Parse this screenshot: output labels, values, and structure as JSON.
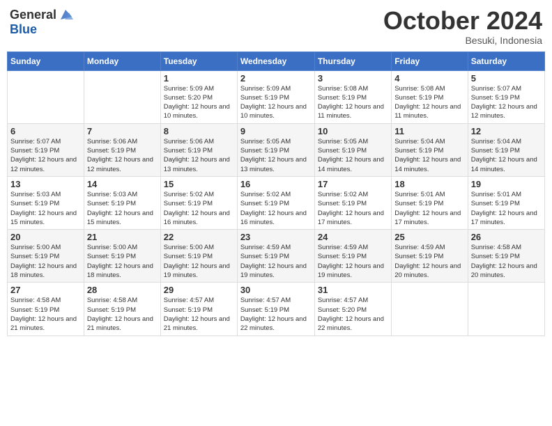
{
  "logo": {
    "general": "General",
    "blue": "Blue"
  },
  "header": {
    "month": "October 2024",
    "location": "Besuki, Indonesia"
  },
  "weekdays": [
    "Sunday",
    "Monday",
    "Tuesday",
    "Wednesday",
    "Thursday",
    "Friday",
    "Saturday"
  ],
  "weeks": [
    [
      {
        "day": "",
        "info": ""
      },
      {
        "day": "",
        "info": ""
      },
      {
        "day": "1",
        "info": "Sunrise: 5:09 AM\nSunset: 5:20 PM\nDaylight: 12 hours and 10 minutes."
      },
      {
        "day": "2",
        "info": "Sunrise: 5:09 AM\nSunset: 5:19 PM\nDaylight: 12 hours and 10 minutes."
      },
      {
        "day": "3",
        "info": "Sunrise: 5:08 AM\nSunset: 5:19 PM\nDaylight: 12 hours and 11 minutes."
      },
      {
        "day": "4",
        "info": "Sunrise: 5:08 AM\nSunset: 5:19 PM\nDaylight: 12 hours and 11 minutes."
      },
      {
        "day": "5",
        "info": "Sunrise: 5:07 AM\nSunset: 5:19 PM\nDaylight: 12 hours and 12 minutes."
      }
    ],
    [
      {
        "day": "6",
        "info": "Sunrise: 5:07 AM\nSunset: 5:19 PM\nDaylight: 12 hours and 12 minutes."
      },
      {
        "day": "7",
        "info": "Sunrise: 5:06 AM\nSunset: 5:19 PM\nDaylight: 12 hours and 12 minutes."
      },
      {
        "day": "8",
        "info": "Sunrise: 5:06 AM\nSunset: 5:19 PM\nDaylight: 12 hours and 13 minutes."
      },
      {
        "day": "9",
        "info": "Sunrise: 5:05 AM\nSunset: 5:19 PM\nDaylight: 12 hours and 13 minutes."
      },
      {
        "day": "10",
        "info": "Sunrise: 5:05 AM\nSunset: 5:19 PM\nDaylight: 12 hours and 14 minutes."
      },
      {
        "day": "11",
        "info": "Sunrise: 5:04 AM\nSunset: 5:19 PM\nDaylight: 12 hours and 14 minutes."
      },
      {
        "day": "12",
        "info": "Sunrise: 5:04 AM\nSunset: 5:19 PM\nDaylight: 12 hours and 14 minutes."
      }
    ],
    [
      {
        "day": "13",
        "info": "Sunrise: 5:03 AM\nSunset: 5:19 PM\nDaylight: 12 hours and 15 minutes."
      },
      {
        "day": "14",
        "info": "Sunrise: 5:03 AM\nSunset: 5:19 PM\nDaylight: 12 hours and 15 minutes."
      },
      {
        "day": "15",
        "info": "Sunrise: 5:02 AM\nSunset: 5:19 PM\nDaylight: 12 hours and 16 minutes."
      },
      {
        "day": "16",
        "info": "Sunrise: 5:02 AM\nSunset: 5:19 PM\nDaylight: 12 hours and 16 minutes."
      },
      {
        "day": "17",
        "info": "Sunrise: 5:02 AM\nSunset: 5:19 PM\nDaylight: 12 hours and 17 minutes."
      },
      {
        "day": "18",
        "info": "Sunrise: 5:01 AM\nSunset: 5:19 PM\nDaylight: 12 hours and 17 minutes."
      },
      {
        "day": "19",
        "info": "Sunrise: 5:01 AM\nSunset: 5:19 PM\nDaylight: 12 hours and 17 minutes."
      }
    ],
    [
      {
        "day": "20",
        "info": "Sunrise: 5:00 AM\nSunset: 5:19 PM\nDaylight: 12 hours and 18 minutes."
      },
      {
        "day": "21",
        "info": "Sunrise: 5:00 AM\nSunset: 5:19 PM\nDaylight: 12 hours and 18 minutes."
      },
      {
        "day": "22",
        "info": "Sunrise: 5:00 AM\nSunset: 5:19 PM\nDaylight: 12 hours and 19 minutes."
      },
      {
        "day": "23",
        "info": "Sunrise: 4:59 AM\nSunset: 5:19 PM\nDaylight: 12 hours and 19 minutes."
      },
      {
        "day": "24",
        "info": "Sunrise: 4:59 AM\nSunset: 5:19 PM\nDaylight: 12 hours and 19 minutes."
      },
      {
        "day": "25",
        "info": "Sunrise: 4:59 AM\nSunset: 5:19 PM\nDaylight: 12 hours and 20 minutes."
      },
      {
        "day": "26",
        "info": "Sunrise: 4:58 AM\nSunset: 5:19 PM\nDaylight: 12 hours and 20 minutes."
      }
    ],
    [
      {
        "day": "27",
        "info": "Sunrise: 4:58 AM\nSunset: 5:19 PM\nDaylight: 12 hours and 21 minutes."
      },
      {
        "day": "28",
        "info": "Sunrise: 4:58 AM\nSunset: 5:19 PM\nDaylight: 12 hours and 21 minutes."
      },
      {
        "day": "29",
        "info": "Sunrise: 4:57 AM\nSunset: 5:19 PM\nDaylight: 12 hours and 21 minutes."
      },
      {
        "day": "30",
        "info": "Sunrise: 4:57 AM\nSunset: 5:19 PM\nDaylight: 12 hours and 22 minutes."
      },
      {
        "day": "31",
        "info": "Sunrise: 4:57 AM\nSunset: 5:20 PM\nDaylight: 12 hours and 22 minutes."
      },
      {
        "day": "",
        "info": ""
      },
      {
        "day": "",
        "info": ""
      }
    ]
  ]
}
